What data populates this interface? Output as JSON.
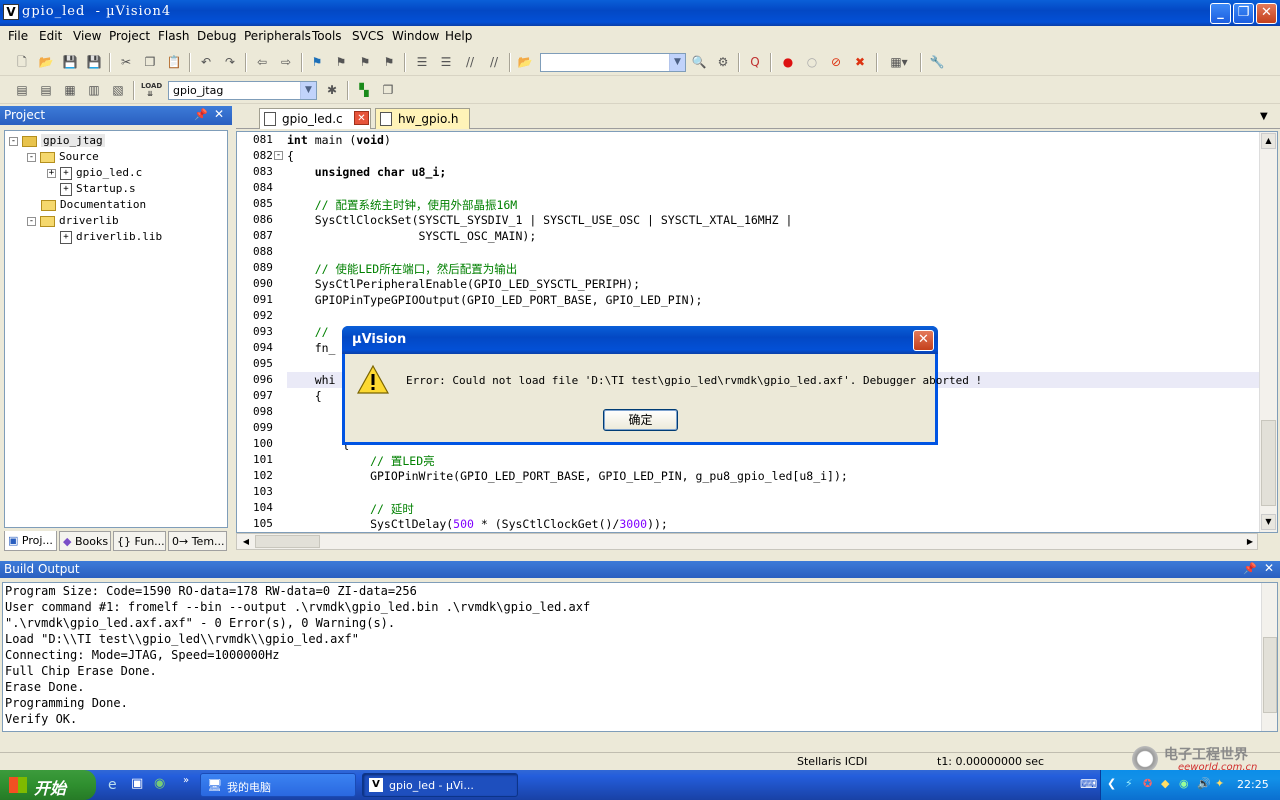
{
  "window": {
    "title": "gpio_led  - µVision4"
  },
  "menu": [
    "File",
    "Edit",
    "View",
    "Project",
    "Flash",
    "Debug",
    "Peripherals",
    "Tools",
    "SVCS",
    "Window",
    "Help"
  ],
  "toolbar": {
    "target": "gpio_jtag",
    "search_value": "",
    "load_label": "LOAD"
  },
  "project": {
    "title": "Project",
    "tree": [
      {
        "label": "gpio_jtag",
        "level": 0,
        "type": "target",
        "expander": "-"
      },
      {
        "label": "Source",
        "level": 1,
        "type": "folder",
        "expander": "-"
      },
      {
        "label": "gpio_led.c",
        "level": 2,
        "type": "file",
        "expander": "+"
      },
      {
        "label": "Startup.s",
        "level": 2,
        "type": "file",
        "expander": ""
      },
      {
        "label": "Documentation",
        "level": 1,
        "type": "folder",
        "expander": ""
      },
      {
        "label": "driverlib",
        "level": 1,
        "type": "folder",
        "expander": "-"
      },
      {
        "label": "driverlib.lib",
        "level": 2,
        "type": "file",
        "expander": ""
      }
    ],
    "tabs": [
      "Proj...",
      "Books",
      "{} Fun...",
      "0→ Tem..."
    ]
  },
  "editor": {
    "tabs": [
      {
        "label": "gpio_led.c",
        "active": true
      },
      {
        "label": "hw_gpio.h",
        "active": false
      }
    ],
    "lines": [
      {
        "n": "081",
        "t": "int main (void)"
      },
      {
        "n": "082",
        "t": "{"
      },
      {
        "n": "083",
        "t": "    unsigned char u8_i;"
      },
      {
        "n": "084",
        "t": ""
      },
      {
        "n": "085",
        "t": "    // 配置系统主时钟，使用外部晶振16M"
      },
      {
        "n": "086",
        "t": "    SysCtlClockSet(SYSCTL_SYSDIV_1 | SYSCTL_USE_OSC | SYSCTL_XTAL_16MHZ |"
      },
      {
        "n": "087",
        "t": "                   SYSCTL_OSC_MAIN);"
      },
      {
        "n": "088",
        "t": ""
      },
      {
        "n": "089",
        "t": "    // 使能LED所在端口，然后配置为输出"
      },
      {
        "n": "090",
        "t": "    SysCtlPeripheralEnable(GPIO_LED_SYSCTL_PERIPH);"
      },
      {
        "n": "091",
        "t": "    GPIOPinTypeGPIOOutput(GPIO_LED_PORT_BASE, GPIO_LED_PIN);"
      },
      {
        "n": "092",
        "t": ""
      },
      {
        "n": "093",
        "t": "    //"
      },
      {
        "n": "094",
        "t": "    fn_"
      },
      {
        "n": "095",
        "t": ""
      },
      {
        "n": "096",
        "t": "    whi"
      },
      {
        "n": "097",
        "t": "    {"
      },
      {
        "n": "098",
        "t": ""
      },
      {
        "n": "099",
        "t": ""
      },
      {
        "n": "100",
        "t": "        {"
      },
      {
        "n": "101",
        "t": "            // 置LED亮"
      },
      {
        "n": "102",
        "t": "            GPIOPinWrite(GPIO_LED_PORT_BASE, GPIO_LED_PIN, g_pu8_gpio_led[u8_i]);"
      },
      {
        "n": "103",
        "t": ""
      },
      {
        "n": "104",
        "t": "            // 延时"
      },
      {
        "n": "105",
        "t": "            SysCtlDelay(500 * (SysCtlClockGet()/3000));"
      }
    ]
  },
  "build": {
    "title": "Build Output",
    "lines": [
      "Program Size: Code=1590 RO-data=178 RW-data=0 ZI-data=256",
      "User command #1: fromelf --bin --output .\\rvmdk\\gpio_led.bin .\\rvmdk\\gpio_led.axf",
      "\".\\rvmdk\\gpio_led.axf.axf\" - 0 Error(s), 0 Warning(s).",
      "Load \"D:\\\\TI test\\\\gpio_led\\\\rvmdk\\\\gpio_led.axf\"",
      "Connecting: Mode=JTAG, Speed=1000000Hz",
      "Full Chip Erase Done.",
      "Erase Done.",
      "Programming Done.",
      "Verify OK."
    ]
  },
  "status": {
    "debugger": "Stellaris ICDI",
    "time": "t1: 0.00000000 sec"
  },
  "dialog": {
    "title": "µVision",
    "message": "Error: Could not load file 'D:\\TI test\\gpio_led\\rvmdk\\gpio_led.axf'. Debugger aborted !",
    "ok_label": "确定"
  },
  "taskbar": {
    "start_label": "开始",
    "items": [
      {
        "label": "我的电脑"
      },
      {
        "label": "gpio_led  - µVi..."
      }
    ],
    "clock": "22:25"
  },
  "watermark": {
    "line1": "电子工程世界",
    "line2": "eeworld.com.cn"
  }
}
